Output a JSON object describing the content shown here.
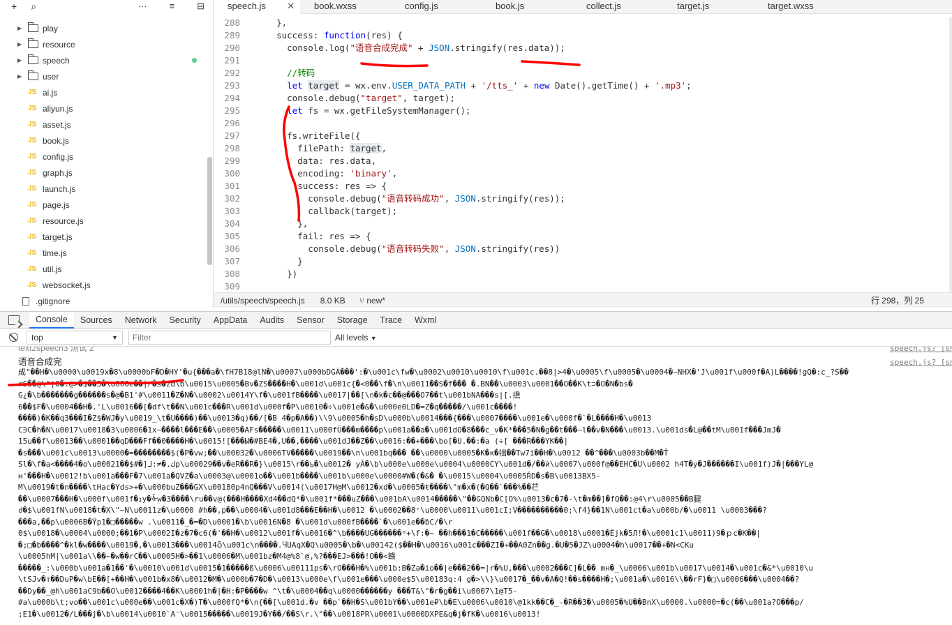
{
  "explorer": {
    "toolbar": {
      "add": "+",
      "search": "⌕",
      "more": "···",
      "sort": "≡",
      "collapse": "⊟"
    },
    "items": [
      {
        "type": "folder",
        "label": "play"
      },
      {
        "type": "folder",
        "label": "resource"
      },
      {
        "type": "folder",
        "label": "speech",
        "modified": true
      },
      {
        "type": "folder",
        "label": "user"
      },
      {
        "type": "js",
        "label": "ai.js"
      },
      {
        "type": "js",
        "label": "aliyun.js"
      },
      {
        "type": "js",
        "label": "asset.js"
      },
      {
        "type": "js",
        "label": "book.js"
      },
      {
        "type": "js",
        "label": "config.js"
      },
      {
        "type": "js",
        "label": "graph.js"
      },
      {
        "type": "js",
        "label": "launch.js"
      },
      {
        "type": "js",
        "label": "page.js"
      },
      {
        "type": "js",
        "label": "resource.js"
      },
      {
        "type": "js",
        "label": "target.js"
      },
      {
        "type": "js",
        "label": "time.js"
      },
      {
        "type": "js",
        "label": "util.js"
      },
      {
        "type": "js",
        "label": "websocket.js"
      },
      {
        "type": "file",
        "label": ".gitignore"
      }
    ],
    "js_badge": "JS"
  },
  "editor": {
    "tabs": [
      {
        "label": "speech.js",
        "active": true
      },
      {
        "label": "book.wxss"
      },
      {
        "label": "config.js"
      },
      {
        "label": "book.js"
      },
      {
        "label": "collect.js"
      },
      {
        "label": "target.js"
      },
      {
        "label": "target.wxss"
      }
    ],
    "close_icon": "✕",
    "lines": [
      {
        "n": "288",
        "html": "    },"
      },
      {
        "n": "289",
        "html": "    success: <span class='kw'>function</span>(res) {"
      },
      {
        "n": "290",
        "html": "      console.log(<span class='str'>\"语音合成完成\"</span> + <span class='const'>JSON</span>.stringify(res.data));"
      },
      {
        "n": "291",
        "html": ""
      },
      {
        "n": "292",
        "html": "      <span class='cm'>//转码</span>"
      },
      {
        "n": "293",
        "html": "      <span class='kw'>let</span> <span class='hl'>target</span> = wx.env.<span class='const'>USER_DATA_PATH</span> + <span class='str'>'/tts_'</span> + <span class='kw'>new</span> Date().getTime() + <span class='str'>'.mp3'</span>;"
      },
      {
        "n": "294",
        "html": "      console.debug(<span class='str'>\"target\"</span>, target);"
      },
      {
        "n": "295",
        "html": "      <span class='kw'>let</span> fs = wx.getFileSystemManager();"
      },
      {
        "n": "296",
        "html": ""
      },
      {
        "n": "297",
        "html": "      fs.writeFile({"
      },
      {
        "n": "298",
        "html": "        filePath: <span class='hl'>target</span>,"
      },
      {
        "n": "299",
        "html": "        data: res.data,"
      },
      {
        "n": "300",
        "html": "        encoding: <span class='str'>'binary'</span>,"
      },
      {
        "n": "301",
        "html": "        success: res => {"
      },
      {
        "n": "302",
        "html": "          console.debug(<span class='str'>\"语音转码成功\"</span>, <span class='const'>JSON</span>.stringify(res));"
      },
      {
        "n": "303",
        "html": "          callback(target);"
      },
      {
        "n": "304",
        "html": "        },"
      },
      {
        "n": "305",
        "html": "        fail: res => {"
      },
      {
        "n": "306",
        "html": "          console.debug(<span class='str'>\"语音转码失败\"</span>, <span class='const'>JSON</span>.stringify(res))"
      },
      {
        "n": "307",
        "html": "        }"
      },
      {
        "n": "308",
        "html": "      })"
      },
      {
        "n": "309",
        "html": ""
      }
    ],
    "status": {
      "path": "/utils/speech/speech.js",
      "size": "8.0 KB",
      "branch": "new*",
      "position": "行 298，列 25"
    }
  },
  "devtools": {
    "tabs": [
      "Console",
      "Sources",
      "Network",
      "Security",
      "AppData",
      "Audits",
      "Sensor",
      "Storage",
      "Trace",
      "Wxml"
    ],
    "active_tab": "Console",
    "context": "top",
    "filter_placeholder": "Filter",
    "levels": "All levels",
    "prev_log": "text2speech3 测试 2",
    "prev_source": "speech.js? [sm]",
    "head_log": "语音合成完",
    "head_source": "speech.js? [sm]",
    "garbage_lines": [
      "成\"��H�\\u0000\\u0019x�8\\u0000bF�D�HY'�u{���a�\\fH7B18@lN�\\u0007\\u000bDGÁ���':�\\u001c\\fw�\\u0002\\u0010\\u0010\\f\\u001c.��8|>4�\\u0005\\f\\u0005�\\u0004�~NHX�'J\\u001f\\u000f�A)L����!gQ�:c_?S��",
      "rS��@\\\"|O�.@>�$��3�\\u000e��∤�≤�zd\\b\\u0015\\u0005�Bv�ZS����H�\\u001d\\u001c{�<0��\\f�\\n\\u0011��S�f��� �.BN��\\u0003\\u0001��O��K\\t⊃�O�N�bs�",
      "G¿�\\b�������g������s�@�B1'#\\u0011�Z�N�\\u0002\\u0014Y\\f�\\u001fB����\\u0017|��[\\n�k�c��@���O7��t\\u001bNA���s|[.擔",
      "6��$F�\\u0004��H�.'L\\u0016��[�df\\t��N\\u001c���R\\u001d\\u000f�P\\u0010�÷\\u001e�&�\\u000e0LD�=Z�q�����/\\u001c����!",
      "����)�K��q3���I�Z$�WJ�y\\u0019_\\t�U����)��\\u0013�q)��/[�B 4�p�A��)\\\\9\\u0005�h�sD\\u000b\\u0014���{���\\u0007����\\u001e�\\u000f�`�L����H�\\u0013",
      "C∋C�h�N\\u0017\\u0018�3\\u0006�1x~����l���E��\\u0005�AFs�����\\u0011\\u000fÜ���m����p\\u001a��a�\\u001dO�8���c_v�K*���5�N�g��t���~l��v�N���\\u0013.\\u001ds�L@��tM\\u001f���JmJ�",
      "15u��f\\u0013��\\u0001��qD���Ff��0����H�\\u0015![���Ы�#BE4�,U��,����\\u001dJ��Z��\\u0016:��+���\\bo[�U.��:�a (÷[ ���R���YK��|",
      "�s���\\u001c\\u0013\\u0000�=��������$(�P�vw;��\\u00032�\\u0006TV�����\\u0019��\\n\\u001bq��� ��\\u0000\\u0005�K�κ�拙��Tw7i��H�\\u0012 ��^���\\u0003b��M�Ť",
      "Sl�\\f�a<����4�o\\u00021��$#�]ᒧ:≠�.ﻙ‌p\\u00029��v�eR��R�}\\u0015\\r��ъ�\\u0012� yÃ�\\b\\u000e\\u000e\\u0004\\u0000CY\\u001d�/��ѝ\\u0007\\u000f@��EHC�U\\u0002 h4T�y�J������I\\u001f)J�|���YL@",
      "ʜ'���H�\\u0012!b\\u001a���F�7\\u001a�QVZ�a\\u0003@\\u0001o��\\u001b����\\u001b\\u000e\\u0000#W�(�&� �\\u0015\\u0004\\u0005ŘD�s�B\\u0013BX5-",
      "M\\u0019�t�n����\\tHac�Yds>+�\\u000buZ���GX\\u00180p4nQ���V\\u0014(\\u0017H@M\\u0012�xd�\\u0005�ŧ����\\\"m�x�(�Q��`���%��芢",
      "��\\u0007���H�\\u000f\\u001f�ｭy�ᢤw�3����\\ru��v@(���H����Xd4��dQ*�\\u001f*���uZ���\\u001bA\\u0014�����\\\"��GQNb�C[O%\\u0013�c�7�-\\t�m��]�fQ��:@4\\r\\u0005��B腱",
      "ძ�$\\u001fN\\u0018�t�X\\\"~N\\u0011z�\\u0000 #h��,p��\\u0004�\\u001d8���E��H�\\u0012 �\\u0002��8⁺\\u0000\\u0011\\u001cI;V����������0;\\f4}��1N\\u001ct�a\\u000b/�\\u0011 \\u0003���?",
      "���a,��p\\u0006B�Ÿp1�□�����w .\\u0011�_�=�D\\u0001�\\b\\u0016N�8 �\\u001d\\u000fB����`�\\u001e��ḃC/�\\r",
      "0$\\u0018�\\u0004\\u0000;��1�P\\u0002I�z�7�c6(�'��H�\\u0012\\u001f�\\u0016�^\\b����UG������ᵃ+\\f:�~ ��h���1�C�����\\u001f��G�\\u0018\\u0001�Ëjk�5Л!�\\u0001c1\\u0011)9�ｐc�K��|",
      "�;□�b����^�kl�w����\\u0019�,�\\u0013���\\u0014Ⴢ\\u001c\\n����.ႷUAqX�Q\\u0005�\\b�\\u00142($��H�\\u0016\\u001c���ZI�≁��A0Zn��g.�U�5�JZ\\u0004�h\\u0017��+�N<CKu",
      "\\u0005hM|\\u001a\\\\��~�w��rC��\\u0005H�>��1\\u0006�M\\u001bz�M4@%8`@,%?���EJ>���!O��<赣",
      "�����_:\\u000b\\u001a�1��'�\\u0010\\u001d\\u0015�1�����ß\\u0006\\u00111ps�\\rO���H�%\\u001b:B�Za�io��|e���2��=|r�%U,���\\u0002���C]�L�� mн�_\\u0006\\u001b\\u0017\\u0014�\\u001c�&*\\u0010\\u",
      "\\tSJv�т��DuP�w\\bE��[+��H�\\u001b�x8�\\u0012�M�\\u000b�7�D�\\u0013\\u000e\\f\\u001e���\\u000e$5\\u00183q:4 g�>\\\\}\\u0017�_��v�A�Q!��s����H�;\\u001a�\\u0016\\\\��rF}�□\\u0006���\\u0004��?",
      "��Dy��_@h\\u001aC9b��O\\u0012����4��K\\u0001h�|�H:�P����w ^\\t�\\u0004��q\\u0000������y ���T&\\\"�r�g��i\\u0007\\1@T5-",
      "#a\\u000b\\t;vo��\\u001c\\u000e��\\u001c�X�)T�\\u000fQ*�\\n{��[\\u001d.�v ��p`��H�S\\u001bY��\\u001e₽\\b�E\\u0006\\u0010\\@1kk��C�_-�R��3�\\u0005�%U��BnX\\u0000.\\u0000=�c(��\\u001a?O���p/",
      ";E1�\\u0012�/L���j�\\b\\u0014\\u0010`A⁻\\u0015�����\\u0019J�Y��/��S\\r.\\\"��\\u0018PR\\u0001\\u0000DXPE&q�j�fK�\\u0016\\u0013!"
    ]
  },
  "colors": {
    "annotation": "#ff0000",
    "keyword": "#0000ff",
    "string": "#a31515",
    "comment": "#008000",
    "active_tab_underline": "#1a73e8"
  },
  "icons": {
    "explorer": [
      "add-icon",
      "search-icon",
      "more-icon",
      "sort-icon",
      "collapse-icon"
    ],
    "devtools": [
      "inspect-icon",
      "clear-console-icon",
      "dropdown-arrow-icon"
    ]
  }
}
